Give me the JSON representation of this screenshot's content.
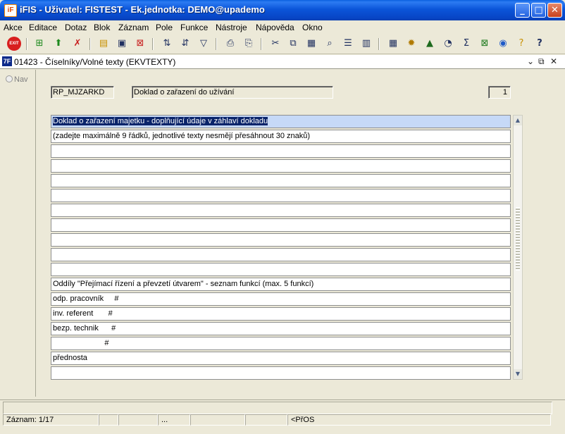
{
  "window": {
    "title": "iFIS - Uživatel: FISTEST - Ek.jednotka: DEMO@upademo"
  },
  "menu": [
    "Akce",
    "Editace",
    "Dotaz",
    "Blok",
    "Záznam",
    "Pole",
    "Funkce",
    "Nástroje",
    "Nápověda",
    "Okno"
  ],
  "toolbar": {
    "exit_label": "EXIT"
  },
  "form": {
    "title": "01423 - Číselníky/Volné texty (EKVTEXTY)",
    "nav_label": "Nav",
    "code": "RP_MJZARKD",
    "description": "Doklad o zařazení do užívání",
    "record_number": "1",
    "rows": [
      "Doklad o zařazení majetku - doplňující údaje v záhlaví dokladu",
      "(zadejte maximálně 9 řádků, jednotlivé texty nesmějí přesáhnout 30 znaků)",
      "",
      "",
      "",
      "",
      "",
      "",
      "",
      "",
      "",
      "Oddíly \"Přejímací řízení a převzetí útvarem\" - seznam funkcí (max. 5 funkcí)",
      "odp. pracovník     #",
      "inv. referent       #",
      "bezp. technik      #",
      "                        #",
      "přednosta",
      ""
    ]
  },
  "status": {
    "record": "Záznam: 1/17",
    "dots": "...",
    "mode": "<PřOS"
  }
}
